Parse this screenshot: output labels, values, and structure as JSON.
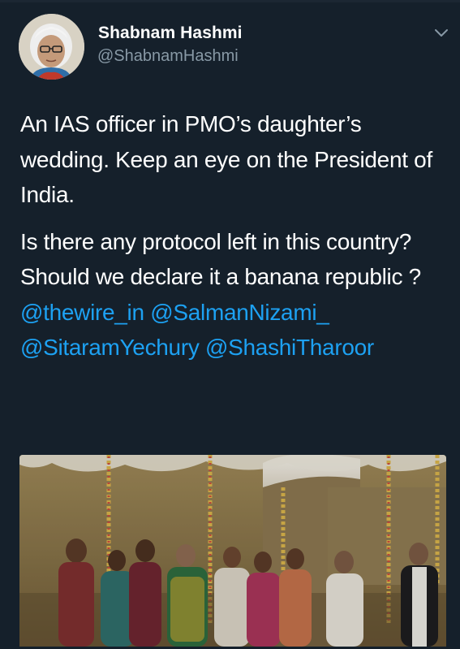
{
  "author": {
    "display_name": "Shabnam Hashmi",
    "handle": "@ShabnamHashmi"
  },
  "tweet": {
    "paragraph1": "An IAS officer in PMO’s  daughter’s wedding. Keep an eye on the President of India.",
    "paragraph2_text": "Is there any protocol left in this country? Should we declare it a banana republic ? ",
    "mentions": [
      "@thewire_in",
      "@SalmanNizami_",
      "@SitaramYechury",
      "@ShashiTharoor"
    ]
  },
  "icons": {
    "menu": "chevron-down-icon"
  },
  "colors": {
    "background": "#15202b",
    "text": "#ffffff",
    "secondary_text": "#8899a6",
    "link": "#1da1f2"
  }
}
